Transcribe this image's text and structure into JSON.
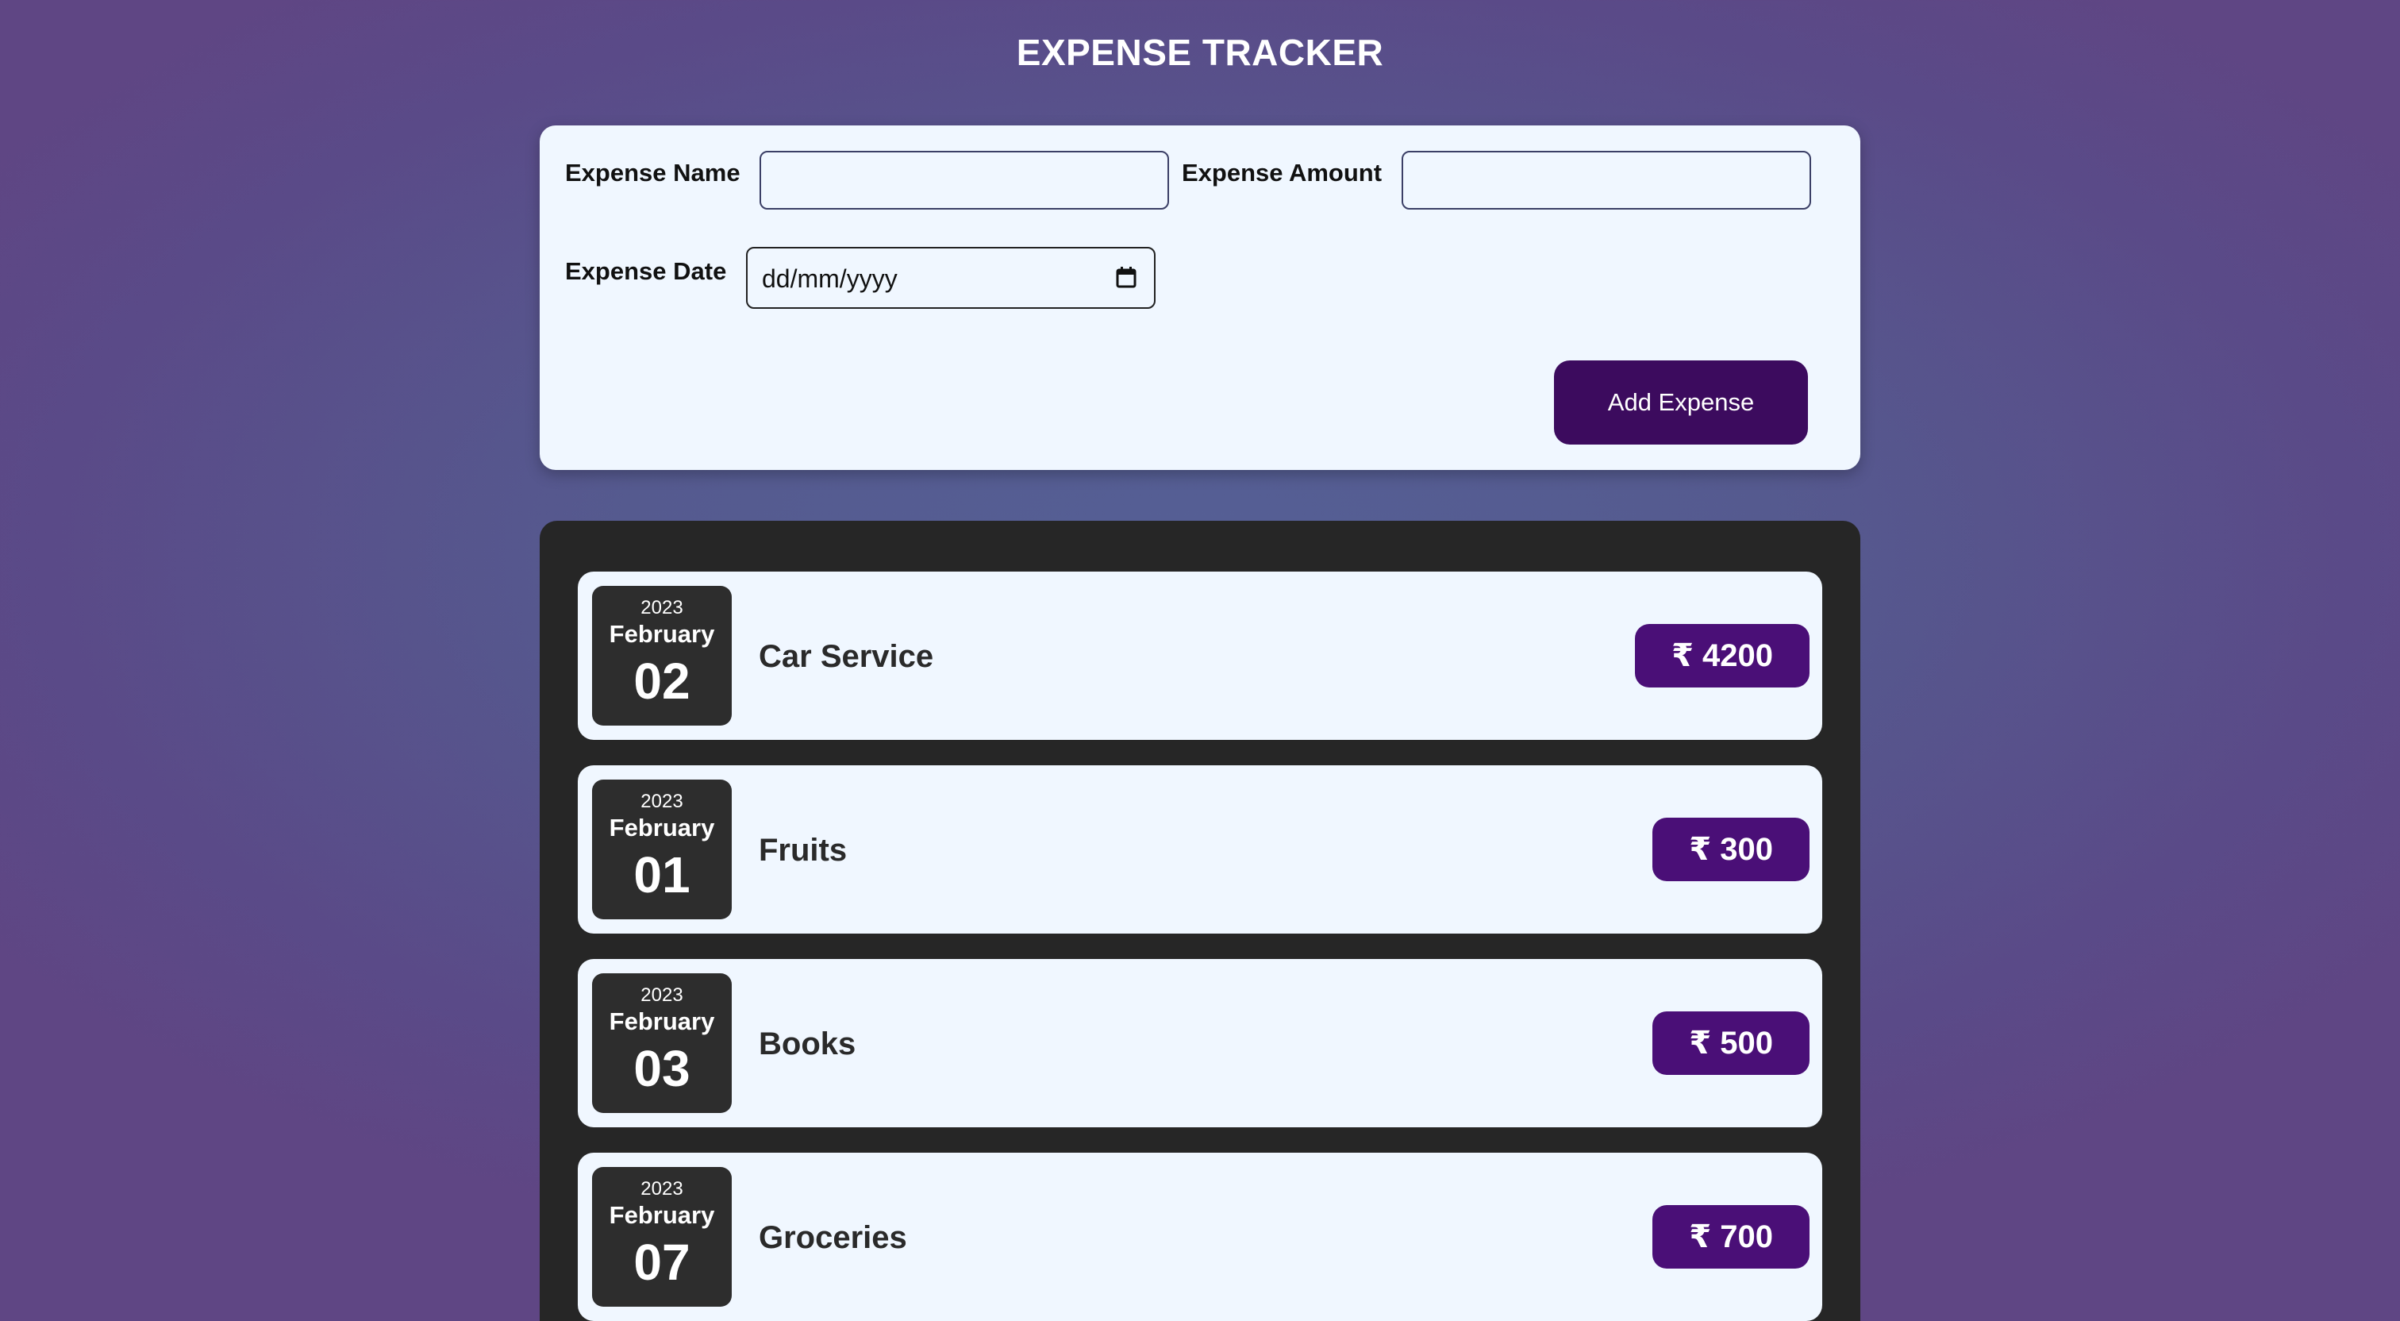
{
  "app": {
    "title": "EXPENSE TRACKER"
  },
  "form": {
    "name_label": "Expense Name",
    "name_value": "",
    "amount_label": "Expense Amount",
    "amount_value": "",
    "date_label": "Expense Date",
    "date_placeholder": "dd/mm/yyyy",
    "add_button": "Add Expense",
    "calendar_icon": "calendar-icon"
  },
  "expenses": [
    {
      "year": "2023",
      "month": "February",
      "day": "02",
      "name": "Car Service",
      "amount": "₹ 4200"
    },
    {
      "year": "2023",
      "month": "February",
      "day": "01",
      "name": "Fruits",
      "amount": "₹ 300"
    },
    {
      "year": "2023",
      "month": "February",
      "day": "03",
      "name": "Books",
      "amount": "₹ 500"
    },
    {
      "year": "2023",
      "month": "February",
      "day": "07",
      "name": "Groceries",
      "amount": "₹ 700"
    }
  ],
  "colors": {
    "button": "#3c0b5e",
    "amount_badge": "#4a0f77",
    "panel": "#262626",
    "card": "#f0f7ff",
    "date_tile": "#2d2d2d"
  }
}
